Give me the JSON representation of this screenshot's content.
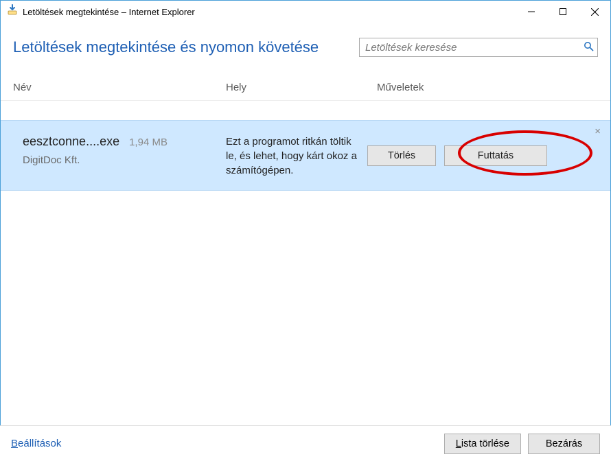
{
  "window": {
    "title": "Letöltések megtekintése – Internet Explorer"
  },
  "header": {
    "heading": "Letöltések megtekintése és nyomon követése",
    "search_placeholder": "Letöltések keresése"
  },
  "columns": {
    "name": "Név",
    "location": "Hely",
    "actions": "Műveletek"
  },
  "downloads": [
    {
      "filename": "eesztconne....exe",
      "size": "1,94 MB",
      "publisher": "DigitDoc Kft.",
      "warning": "Ezt a programot ritkán töltik le, és lehet, hogy kárt okoz a számítógépen.",
      "delete_label": "Törlés",
      "run_label": "Futtatás"
    }
  ],
  "footer": {
    "settings": "Beállítások",
    "settings_accel": "B",
    "settings_rest": "eállítások",
    "clear_list": "Lista törlése",
    "clear_list_accel": "L",
    "clear_list_rest": "ista törlése",
    "close": "Bezárás"
  }
}
